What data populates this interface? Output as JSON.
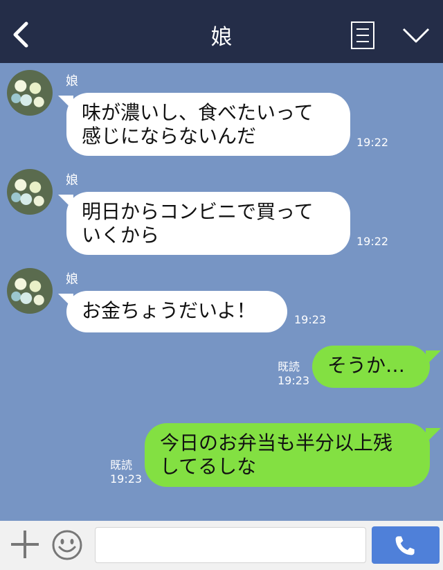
{
  "header": {
    "title": "娘"
  },
  "messages": {
    "m1": {
      "sender": "娘",
      "line1": "味が濃いし、食べたいって",
      "line2": "感じにならないんだ",
      "time": "19:22"
    },
    "m2": {
      "sender": "娘",
      "line1": "明日からコンビニで買って",
      "line2": "いくから",
      "time": "19:22"
    },
    "m3": {
      "sender": "娘",
      "text": "お金ちょうだいよ！",
      "time": "19:23"
    },
    "m4": {
      "read": "既読",
      "time": "19:23",
      "text": "そうか…"
    },
    "m5": {
      "read": "既読",
      "time": "19:23",
      "line1": "今日のお弁当も半分以上残",
      "line2": "してるしな"
    }
  },
  "input": {
    "value": ""
  },
  "colors": {
    "header": "#242d48",
    "chat_bg": "#7795c4",
    "incoming": "#ffffff",
    "outgoing": "#83e042",
    "send_button": "#4f80d9"
  },
  "icons": {
    "back": "chevron-left-icon",
    "notes": "notes-icon",
    "menu": "chevron-down-icon",
    "plus": "plus-icon",
    "emoji": "smiley-icon",
    "call": "phone-icon"
  }
}
